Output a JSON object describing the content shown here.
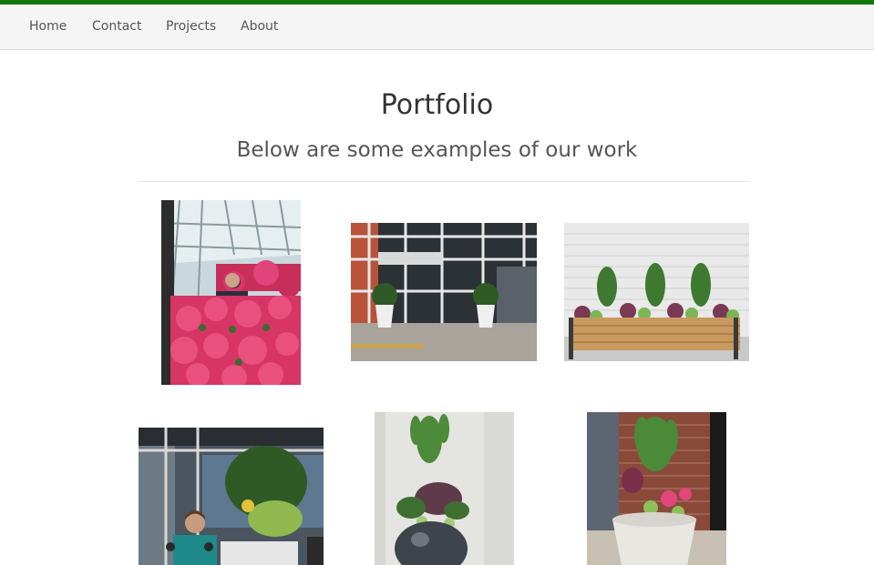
{
  "nav": {
    "items": [
      {
        "label": "Home"
      },
      {
        "label": "Contact"
      },
      {
        "label": "Projects"
      },
      {
        "label": "About"
      }
    ]
  },
  "page": {
    "title": "Portfolio",
    "subtitle": "Below are some examples of our work"
  },
  "colors": {
    "accent_bar": "#137510",
    "nav_bg": "#f5f5f5",
    "nav_text": "#555555",
    "title_text": "#333333"
  }
}
